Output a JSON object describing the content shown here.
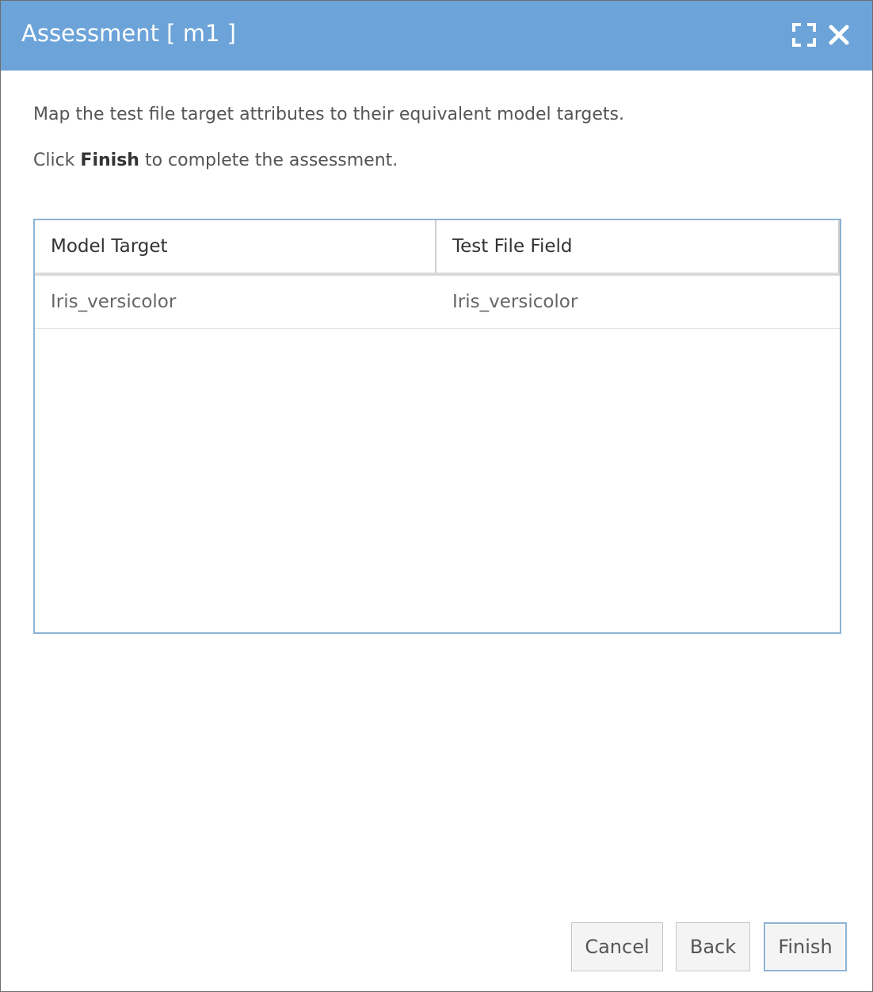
{
  "dialog": {
    "title": "Assessment [ m1 ]",
    "icons": {
      "maximize": "maximize-icon",
      "close": "close-icon"
    }
  },
  "instructions": {
    "line1": "Map the test file target attributes to their equivalent model targets.",
    "line2_prefix": "Click ",
    "line2_bold": "Finish",
    "line2_suffix": " to complete the assessment."
  },
  "grid": {
    "columns": [
      "Model Target",
      "Test File Field"
    ],
    "rows": [
      [
        "Iris_versicolor",
        "Iris_versicolor"
      ]
    ]
  },
  "buttons": {
    "cancel": "Cancel",
    "back": "Back",
    "finish": "Finish"
  },
  "colors": {
    "titlebar": "#6ca3d8",
    "accent_border": "#8db2d6"
  }
}
